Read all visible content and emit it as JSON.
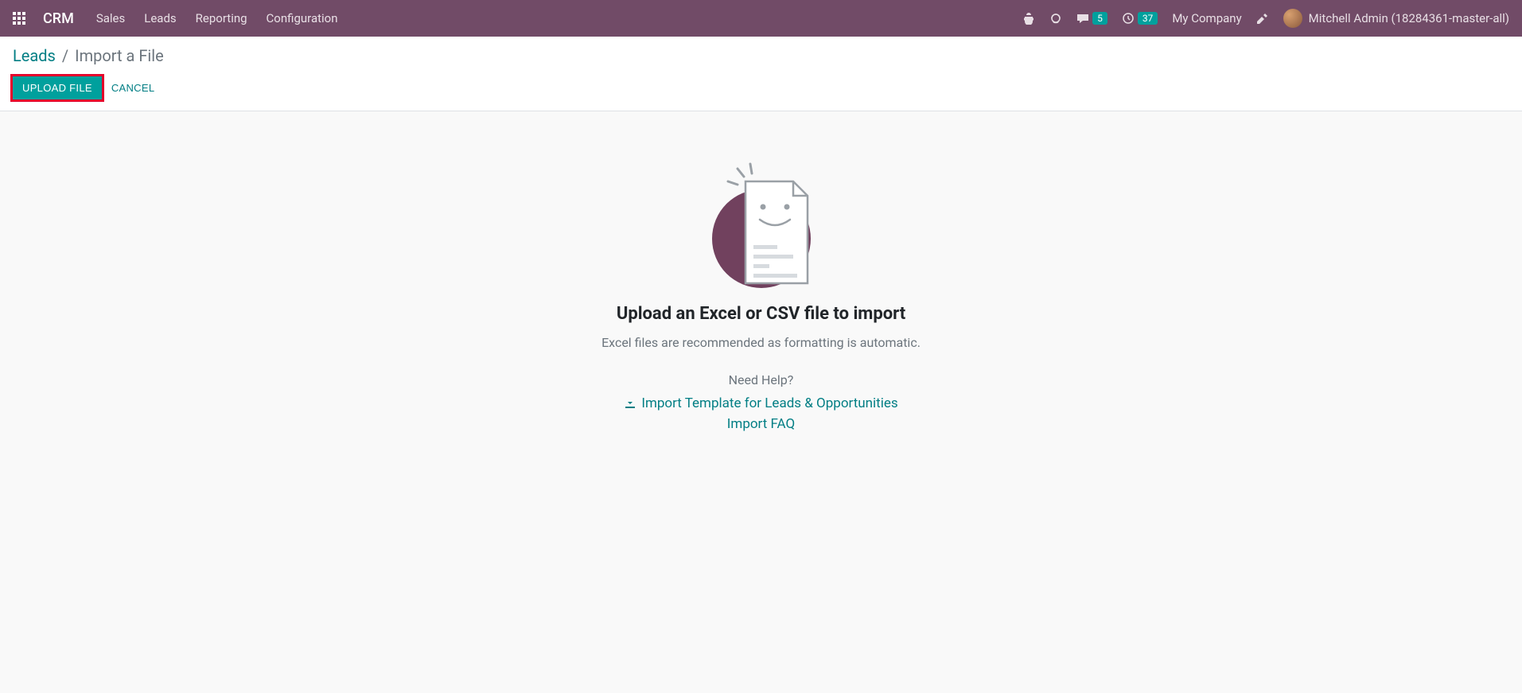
{
  "nav": {
    "brand": "CRM",
    "menu": [
      "Sales",
      "Leads",
      "Reporting",
      "Configuration"
    ],
    "messages_badge": "5",
    "activities_badge": "37",
    "company": "My Company",
    "user": "Mitchell Admin (18284361-master-all)"
  },
  "breadcrumb": {
    "parent": "Leads",
    "current": "Import a File"
  },
  "buttons": {
    "upload": "Upload File",
    "cancel": "Cancel"
  },
  "content": {
    "heading": "Upload an Excel or CSV file to import",
    "subtext": "Excel files are recommended as formatting is automatic.",
    "help_label": "Need Help?",
    "template_link": "Import Template for Leads & Opportunities",
    "faq_link": "Import FAQ"
  }
}
